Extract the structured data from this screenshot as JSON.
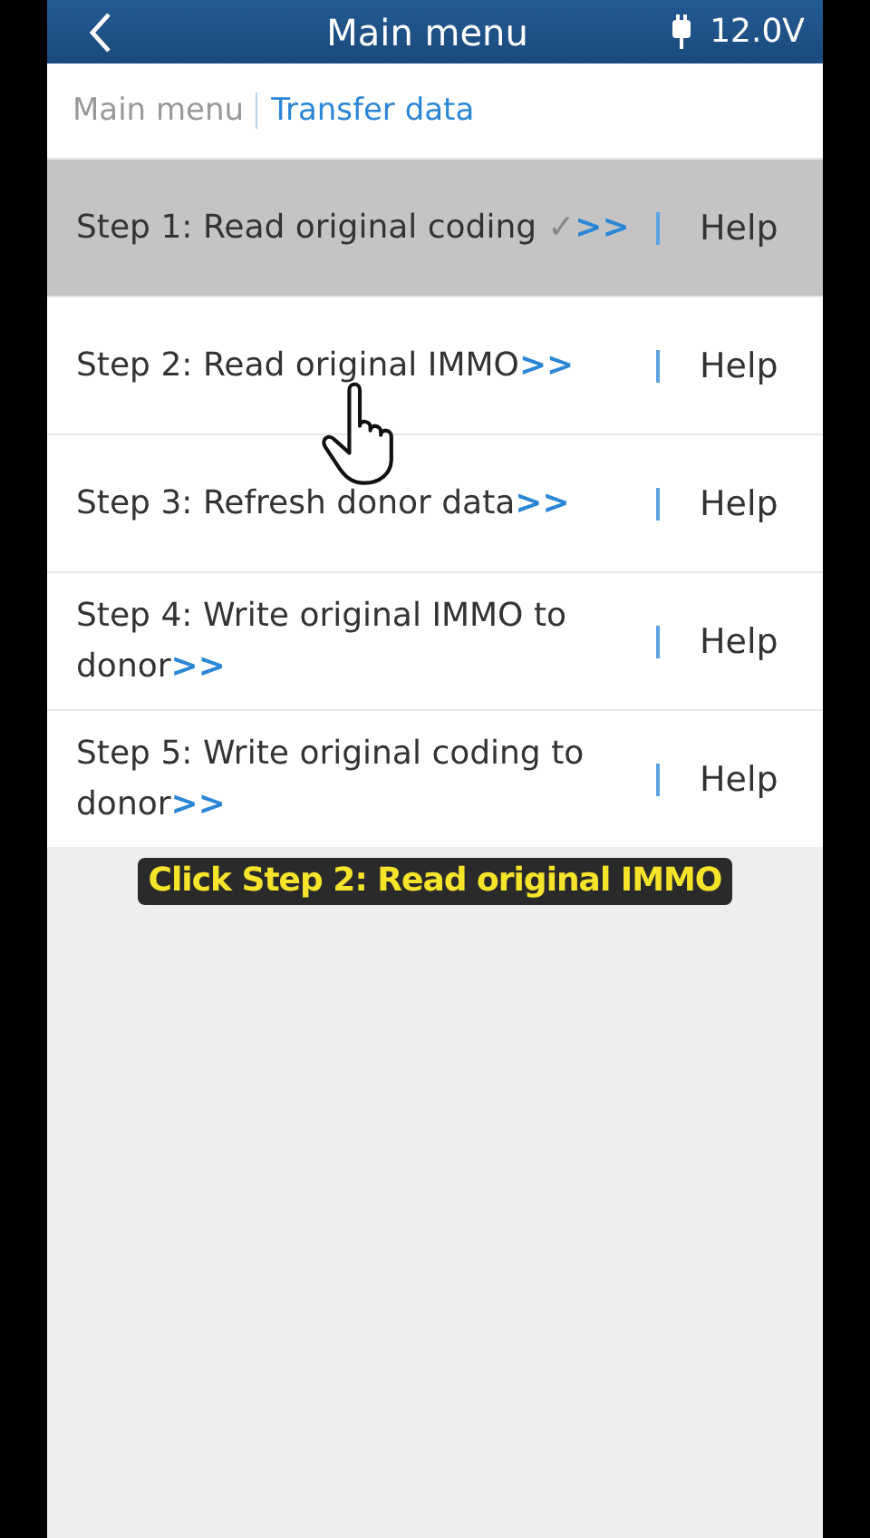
{
  "header": {
    "title": "Main menu",
    "voltage": "12.0V"
  },
  "breadcrumb": [
    {
      "label": "Main menu",
      "selected": false
    },
    {
      "label": "Transfer data",
      "selected": true
    }
  ],
  "steps": [
    {
      "label": "Step 1: Read original coding",
      "mark": "✓",
      "link": ">>",
      "help": "Help",
      "done": true
    },
    {
      "label": "Step 2: Read original IMMO",
      "link": ">>",
      "help": "Help",
      "done": false
    },
    {
      "label": "Step 3: Refresh donor data",
      "link": ">>",
      "help": "Help",
      "done": false
    },
    {
      "label": "Step 4: Write original IMMO to donor",
      "link": ">>",
      "help": "Help",
      "done": false
    },
    {
      "label": "Step 5: Write original coding to donor",
      "link": ">>",
      "help": "Help",
      "done": false
    }
  ],
  "caption": "Click Step 2: Read original IMMO"
}
